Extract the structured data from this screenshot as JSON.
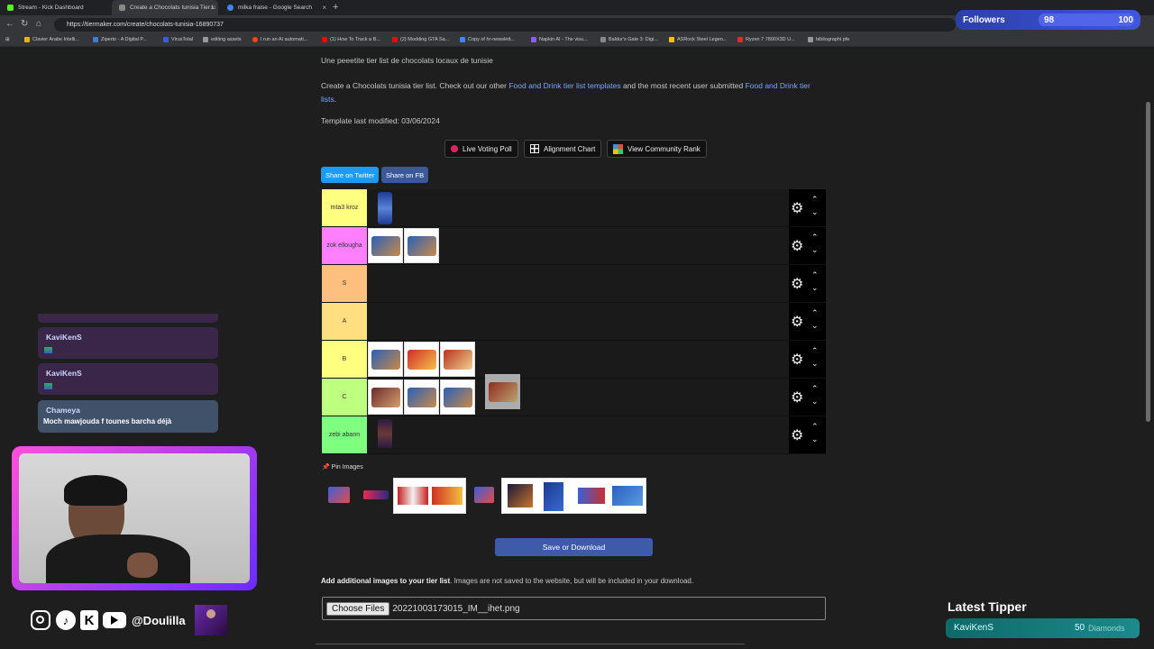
{
  "browser": {
    "tabs": [
      {
        "title": "Stream - Kick Dashboard",
        "color": "#53fc18"
      },
      {
        "title": "Create a Chocolats tunisia Tier Lis",
        "color": "#888888"
      },
      {
        "title": "milka fraise - Google Search",
        "color": "#4285f4"
      }
    ],
    "url": "https://tiermaker.com/create/chocolats-tunisia-16890737",
    "bookmarks": [
      {
        "label": "Clavier Arabe Intelli...",
        "color": "#e8b020"
      },
      {
        "label": "Ziperto - A Digital P...",
        "color": "#3a7bd5"
      },
      {
        "label": "VirusTotal",
        "color": "#3b5bdb"
      },
      {
        "label": "editing assets",
        "color": "#999999"
      },
      {
        "label": "I run an AI automati...",
        "color": "#ff4500"
      },
      {
        "label": "(1) How To Track a B...",
        "color": "#ff0000"
      },
      {
        "label": "(2) Modding GTA Sa...",
        "color": "#ff0000"
      },
      {
        "label": "Copy of hr-newslett...",
        "color": "#4285f4"
      },
      {
        "label": "Napkin AI - The visu...",
        "color": "#8a5cf5"
      },
      {
        "label": "Baldur's Gate 3: Digi...",
        "color": "#888888"
      },
      {
        "label": "ASRock Steel Legen...",
        "color": "#f4c20d"
      },
      {
        "label": "Ryzen 7 7800X3D U...",
        "color": "#d93025"
      },
      {
        "label": "bibliographi pfe",
        "color": "#999999"
      }
    ]
  },
  "followers": {
    "label": "Followers",
    "count": "98",
    "goal": "100"
  },
  "page": {
    "subtitle": "Une peeetite tier list de chocolats locaux de tunisie",
    "intro_a": "Create a Chocolats tunisia tier list. Check out our other ",
    "intro_link1": "Food and Drink tier list templates",
    "intro_b": " and the most recent user submitted ",
    "intro_link2a": "Food and Drink tier",
    "intro_link2b": "lists",
    "intro_c": ".",
    "modified": "Template last modified: 03/06/2024",
    "buttons": {
      "poll": "Live Voting Poll",
      "alignment": "Alignment Chart",
      "rank": "View Community Rank"
    },
    "share_twitter": "Share on Twitter",
    "share_fb": "Share on FB",
    "pin_label": "Pin Images",
    "save": "Save or Download",
    "add_images_bold": "Add additional images to your tier list",
    "add_images_rest": ". Images are not saved to the website, but will be included in your download.",
    "file_button": "Choose Files",
    "file_name": "20221003173015_IM__ihet.png"
  },
  "tiers": [
    {
      "label": "mta3 kroz",
      "color": "#ffff7f",
      "items": [
        "#2b4fae"
      ]
    },
    {
      "label": "zok ellougha",
      "color": "#ff7fff",
      "items": [
        "#2a5fb8",
        "#2a5fb8"
      ]
    },
    {
      "label": "S",
      "color": "#ffbf7f",
      "items": []
    },
    {
      "label": "A",
      "color": "#ffdf7f",
      "items": []
    },
    {
      "label": "B",
      "color": "#ffff7f",
      "items": [
        "#2a5fb8",
        "#d22a2a",
        "#b8321e"
      ]
    },
    {
      "label": "C",
      "color": "#bfff7f",
      "items": [
        "#6b2a2a",
        "#2a5fb8",
        "#2a5fb8"
      ]
    },
    {
      "label": "zebi abann",
      "color": "#7fff7f",
      "items": [
        "#3a2a5a"
      ]
    }
  ],
  "chat": [
    {
      "name": "",
      "msg": ""
    },
    {
      "name": "KaviKenS",
      "msg": ""
    },
    {
      "name": "KaviKenS",
      "msg": ""
    },
    {
      "name": "Chameya",
      "msg": "Moch mawjouda f tounes barcha déjà"
    }
  ],
  "social": {
    "handle": "@Doulilla"
  },
  "tipper": {
    "title": "Latest Tipper",
    "name": "KaviKenS",
    "amount": "50",
    "unit": "Diamonds"
  }
}
